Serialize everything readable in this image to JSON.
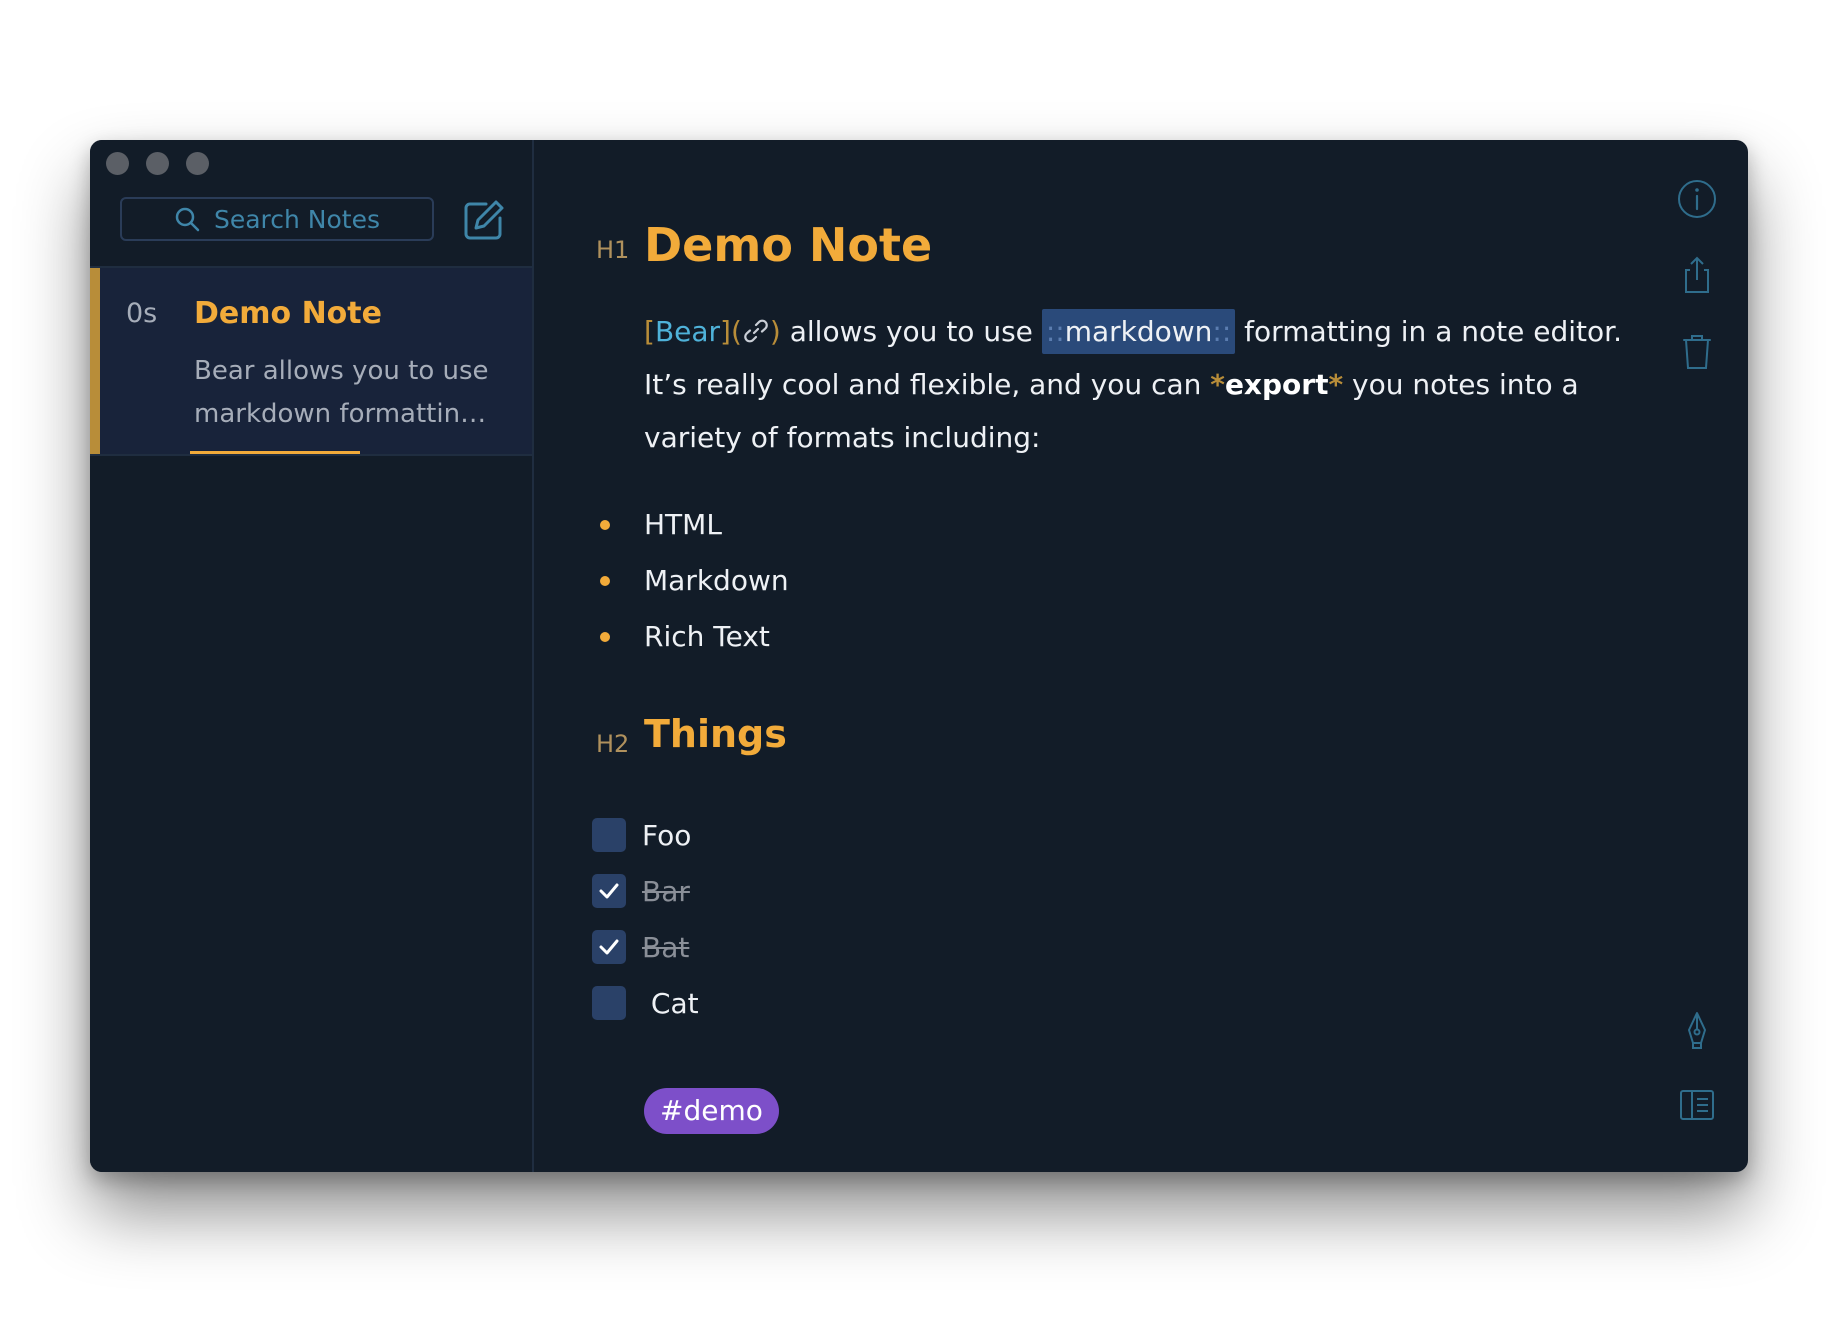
{
  "sidebar": {
    "search": {
      "placeholder": "Search Notes"
    },
    "notes": [
      {
        "time": "0s",
        "title": "Demo Note",
        "preview_line1": "Bear allows you to use",
        "preview_line2": "markdown formattin…"
      }
    ]
  },
  "editor": {
    "h1_marker": "H1",
    "title": "Demo Note",
    "paragraph": {
      "link_open": "[",
      "link_text": "Bear",
      "link_mid": "](",
      "link_close": ")",
      "text1": " allows you to use ",
      "highlight_colon_left": "::",
      "highlight_text": "markdown",
      "highlight_colon_right": "::",
      "text2": " formatting in a note editor. It’s really cool and flexible, and you can ",
      "bold_marker_open": "*",
      "bold_text": "export",
      "bold_marker_close": "*",
      "text3": " you notes into a variety of formats including:"
    },
    "bullets": [
      "HTML",
      "Markdown",
      "Rich Text"
    ],
    "h2_marker": "H2",
    "subheading": "Things",
    "todos": [
      {
        "label": "Foo",
        "checked": false
      },
      {
        "label": "Bar",
        "checked": true
      },
      {
        "label": "Bat",
        "checked": true
      },
      {
        "label": " Cat",
        "checked": false
      }
    ],
    "tag": "#demo"
  },
  "toolbar": {
    "icons": [
      "info-icon",
      "share-icon",
      "trash-icon",
      "pen-icon",
      "sidebar-toggle-icon"
    ]
  },
  "colors": {
    "accent": "#f2ab3a",
    "background": "#121c28",
    "link": "#4fb2d9",
    "tag": "#7d4fc9"
  }
}
